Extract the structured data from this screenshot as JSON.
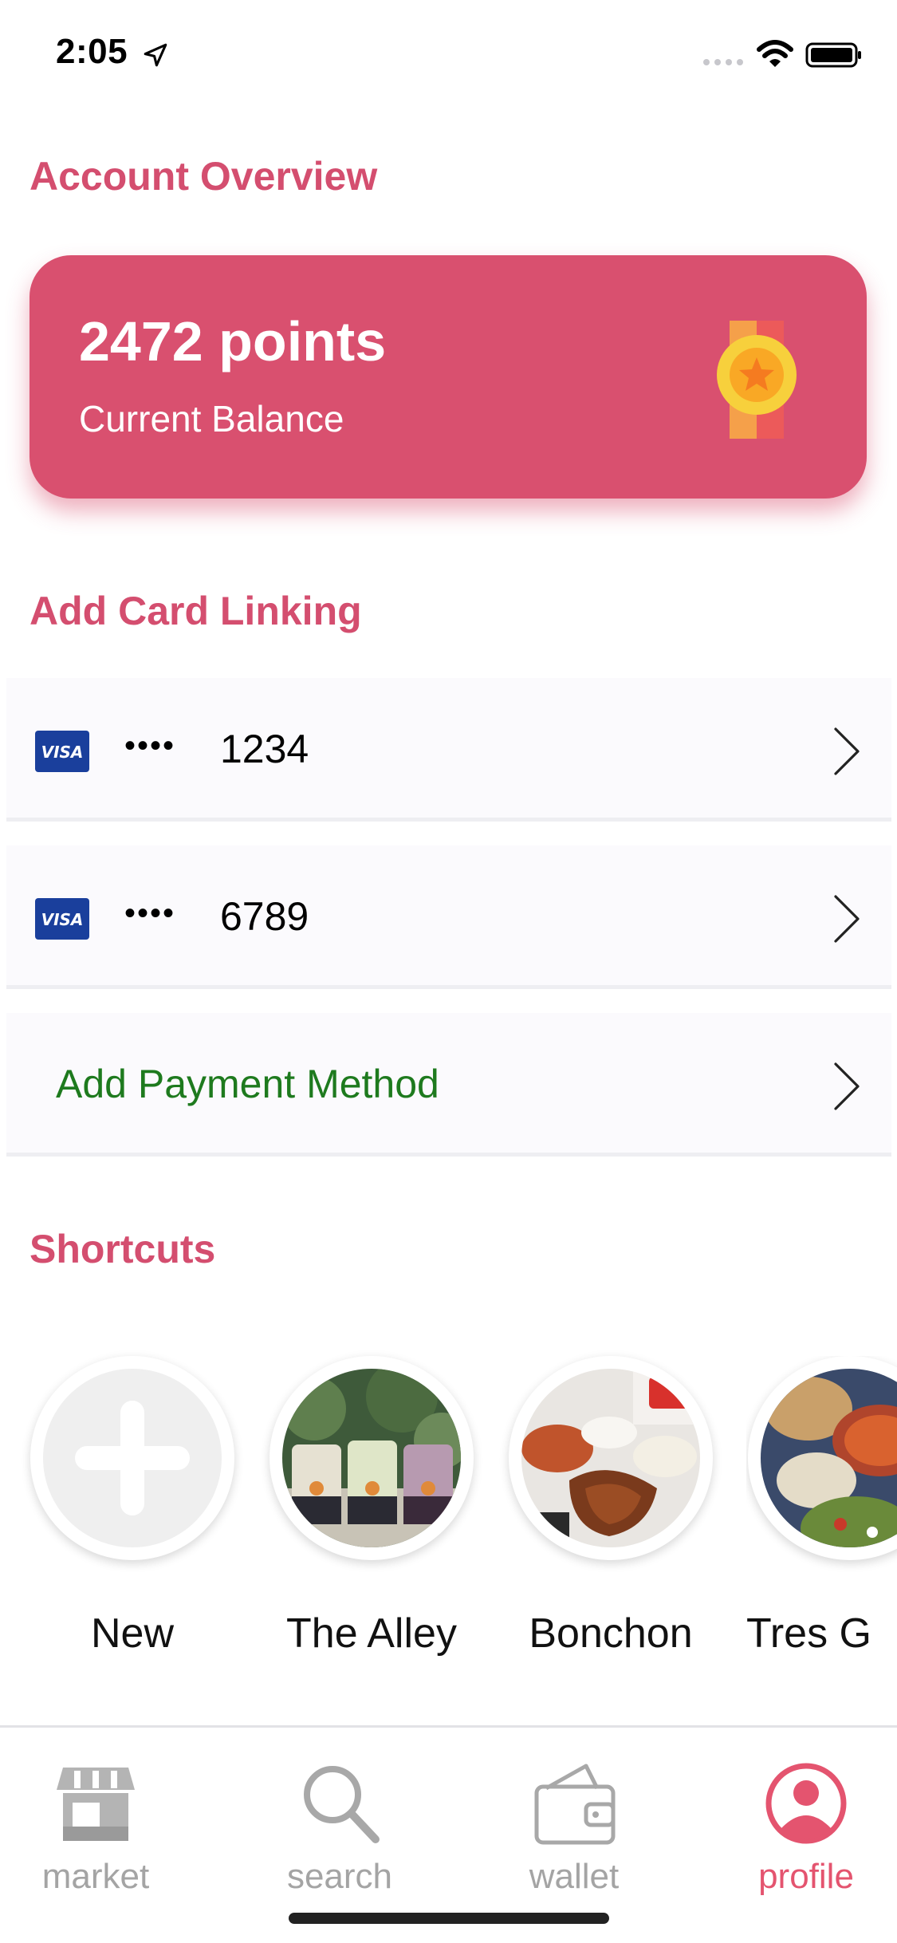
{
  "status_bar": {
    "time": "2:05",
    "icons": [
      "location-arrow-icon",
      "signal-icon",
      "wifi-icon",
      "battery-icon"
    ]
  },
  "account": {
    "title": "Account Overview",
    "balance_points": "2472 points",
    "balance_label": "Current Balance",
    "badge_icon": "medal-icon"
  },
  "cards": {
    "title": "Add Card Linking",
    "items": [
      {
        "brand": "VISA",
        "dots": "••••",
        "last4": "1234"
      },
      {
        "brand": "VISA",
        "dots": "••••",
        "last4": "6789"
      }
    ],
    "add_label": "Add Payment Method"
  },
  "shortcuts": {
    "title": "Shortcuts",
    "items": [
      {
        "label": "New",
        "icon": "plus-icon"
      },
      {
        "label": "The Alley",
        "icon": "store-photo"
      },
      {
        "label": "Bonchon",
        "icon": "store-photo"
      },
      {
        "label": "Tres G",
        "icon": "store-photo"
      }
    ]
  },
  "tabbar": {
    "items": [
      {
        "label": "market",
        "icon": "storefront-icon"
      },
      {
        "label": "search",
        "icon": "magnifier-icon"
      },
      {
        "label": "wallet",
        "icon": "wallet-icon"
      },
      {
        "label": "profile",
        "icon": "user-icon"
      }
    ],
    "active": "profile"
  },
  "colors": {
    "accent": "#d9506f",
    "heading": "#d44e6f",
    "add_payment": "#1e7a1e",
    "tab_inactive": "#a4a4a4",
    "tab_active": "#e4546f"
  }
}
